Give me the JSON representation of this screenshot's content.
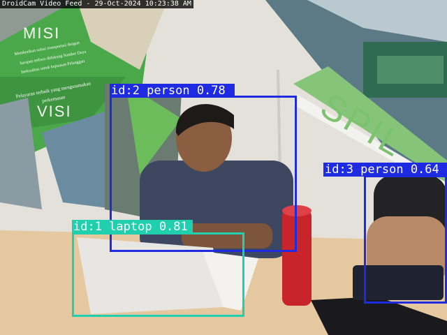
{
  "window": {
    "title": "DroidCam Video Feed - 29-Oct-2024 10:23:38 AM"
  },
  "colors": {
    "person": "#1e2be0",
    "laptop": "#1fcfae",
    "banner_green": "#4aa84a"
  },
  "poster": {
    "misi_heading": "MISI",
    "misi_text_1": "Memberikan solusi transportasi dengan",
    "misi_text_2": "harapan terbaru didukung Sumber Daya",
    "misi_text_3": "berkualitas untuk kepuasan Pelanggan",
    "visi_text_1": "Pelayaran terbaik yang mengutamakan",
    "visi_text_2": "perkemasan",
    "visi_heading": "VISI",
    "logo_text": "SPIL"
  },
  "detections": [
    {
      "id": 2,
      "class": "person",
      "label": "id:2 person 0.78"
    },
    {
      "id": 3,
      "class": "person",
      "label": "id:3 person 0.64"
    },
    {
      "id": 1,
      "class": "laptop",
      "label": "id:1 laptop 0.81"
    }
  ]
}
